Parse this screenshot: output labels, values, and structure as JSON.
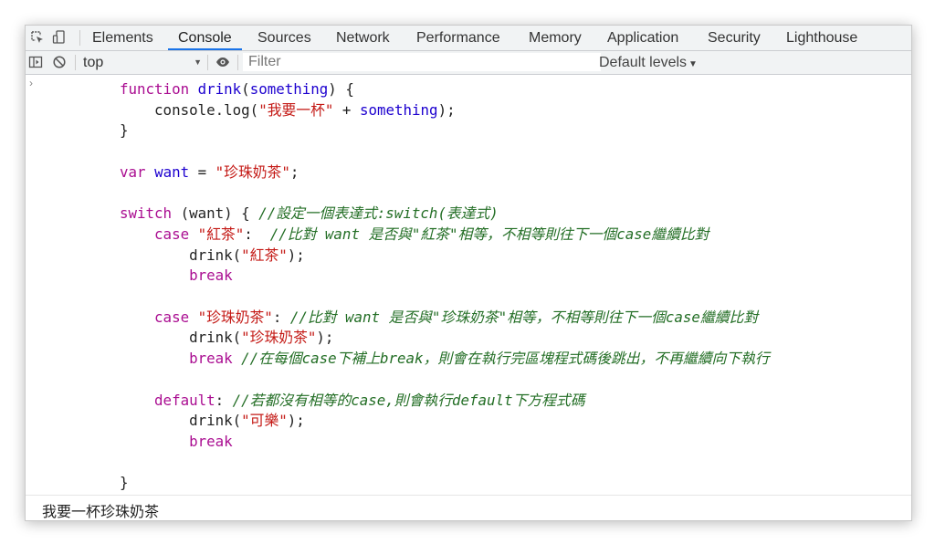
{
  "tabs": [
    "Elements",
    "Console",
    "Sources",
    "Network",
    "Performance",
    "Memory",
    "Application",
    "Security",
    "Lighthouse"
  ],
  "active_tab": "Console",
  "toolbar": {
    "context": "top",
    "filter_placeholder": "Filter",
    "levels": "Default levels"
  },
  "code": {
    "l1": {
      "kw": "function",
      "name": "drink",
      "p1": "(",
      "param": "something",
      "p2": ") {"
    },
    "l2": {
      "a": "console.log(",
      "s": "\"我要一杯\"",
      "b": " + ",
      "v": "something",
      "c": ");"
    },
    "l3": "}",
    "l5": {
      "kw": "var",
      "sp": " ",
      "v": "want",
      "eq": " = ",
      "s": "\"珍珠奶茶\"",
      "end": ";"
    },
    "l7": {
      "kw": "switch",
      "a": " (want) { ",
      "c": "//設定一個表達式:switch(表達式)"
    },
    "l8": {
      "kw": "case",
      "s": "\"紅茶\"",
      "a": ":  ",
      "c": "//比對 want 是否與\"紅茶\"相等，不相等則往下一個case繼續比對"
    },
    "l9": {
      "a": "drink(",
      "s": "\"紅茶\"",
      "b": ");"
    },
    "l10": "break",
    "l12": {
      "kw": "case",
      "s": "\"珍珠奶茶\"",
      "a": ": ",
      "c": "//比對 want 是否與\"珍珠奶茶\"相等，不相等則往下一個case繼續比對"
    },
    "l13": {
      "a": "drink(",
      "s": "\"珍珠奶茶\"",
      "b": ");"
    },
    "l14": {
      "kw": "break",
      "c": "//在每個case下補上break，則會在執行完區塊程式碼後跳出，不再繼續向下執行"
    },
    "l16": {
      "kw": "default",
      "a": ": ",
      "c": "//若都沒有相等的case,則會執行default下方程式碼"
    },
    "l17": {
      "a": "drink(",
      "s": "\"可樂\"",
      "b": ");"
    },
    "l18": "break",
    "l20": "}"
  },
  "output": "我要一杯珍珠奶茶"
}
